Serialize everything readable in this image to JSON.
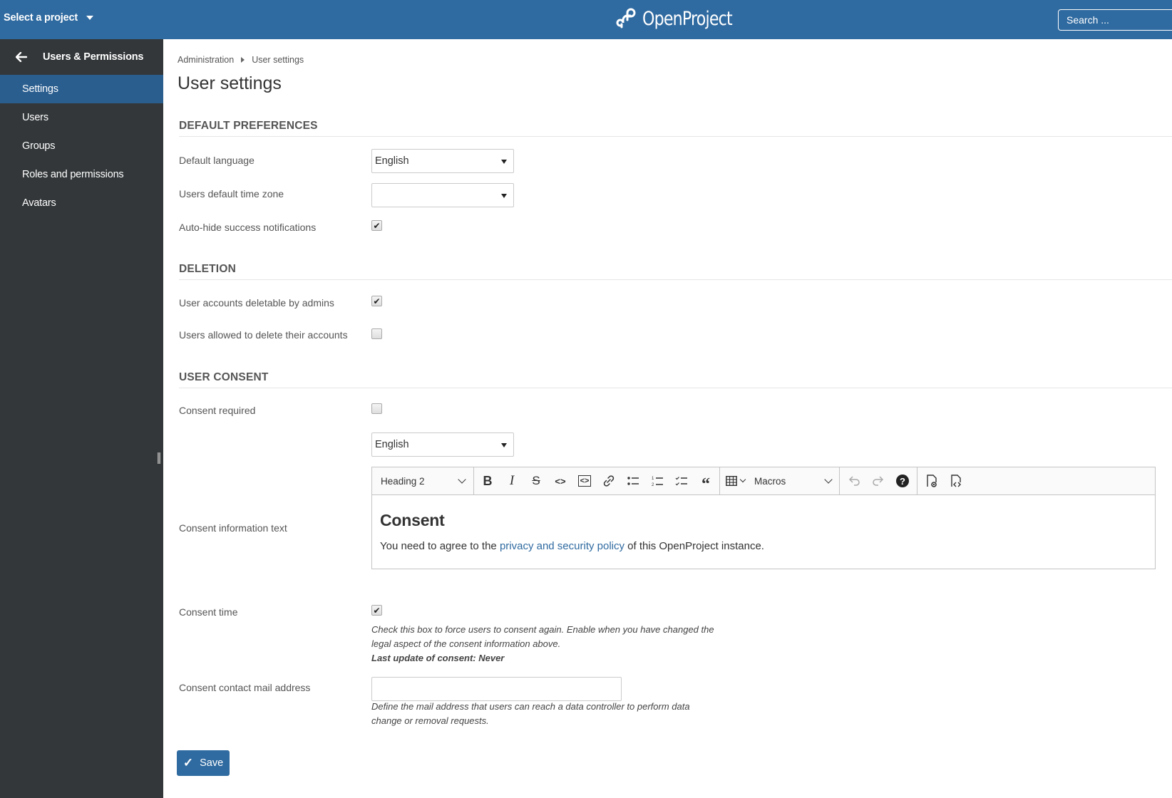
{
  "header": {
    "project_select": "Select a project",
    "logo_text": "OpenProject",
    "search_placeholder": "Search ..."
  },
  "sidebar": {
    "title": "Users & Permissions",
    "items": [
      {
        "label": "Settings",
        "active": true
      },
      {
        "label": "Users",
        "active": false
      },
      {
        "label": "Groups",
        "active": false
      },
      {
        "label": "Roles and permissions",
        "active": false
      },
      {
        "label": "Avatars",
        "active": false
      }
    ]
  },
  "breadcrumb": [
    "Administration",
    "User settings"
  ],
  "page_title": "User settings",
  "sections": {
    "default_preferences": {
      "title": "DEFAULT PREFERENCES",
      "default_language_label": "Default language",
      "default_language_value": "English",
      "time_zone_label": "Users default time zone",
      "time_zone_value": "",
      "auto_hide_label": "Auto-hide success notifications",
      "auto_hide_checked": true
    },
    "deletion": {
      "title": "DELETION",
      "deletable_by_admins_label": "User accounts deletable by admins",
      "deletable_by_admins_checked": true,
      "self_delete_label": "Users allowed to delete their accounts",
      "self_delete_checked": false
    },
    "user_consent": {
      "title": "USER CONSENT",
      "consent_required_label": "Consent required",
      "consent_required_checked": false,
      "language_value": "English",
      "consent_text_label": "Consent information text",
      "editor": {
        "heading_dropdown": "Heading 2",
        "macros_dropdown": "Macros",
        "content_heading": "Consent",
        "content_before_link": "You need to agree to the ",
        "content_link": "privacy and security policy",
        "content_after_link": " of this OpenProject instance."
      },
      "consent_time_label": "Consent time",
      "consent_time_checked": true,
      "consent_time_help": "Check this box to force users to consent again. Enable when you have changed the legal aspect of the consent information above.",
      "last_update": "Last update of consent: Never",
      "contact_mail_label": "Consent contact mail address",
      "contact_mail_value": "",
      "contact_mail_help": "Define the mail address that users can reach a data controller to perform data change or removal requests."
    }
  },
  "save_label": "Save",
  "colors": {
    "header_bg": "#2f6aa0",
    "sidebar_bg": "#333739",
    "sidebar_active": "#2a5e8f",
    "link": "#2f6aa0"
  }
}
